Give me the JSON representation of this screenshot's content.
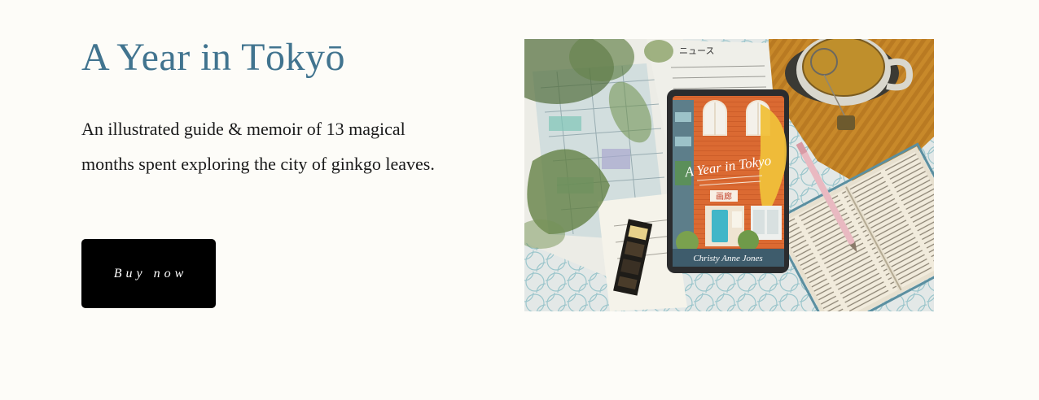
{
  "hero": {
    "title": "A Year in Tōkyō",
    "description": "An illustrated guide & memoir of 13 magical months spent exploring the city of ginkgo leaves.",
    "buy_label": "Buy now"
  },
  "photo": {
    "cover_title": "A Year in Tokyo",
    "cover_sign": "画廊",
    "cover_author": "Christy Anne Jones",
    "newspaper_heading": "ニュース",
    "colors": {
      "title": "#41748f",
      "button_bg": "#000000",
      "page_bg": "#fdfcf8",
      "book_cover_orange": "#d9642e",
      "knit_mustard": "#c8892a"
    }
  }
}
